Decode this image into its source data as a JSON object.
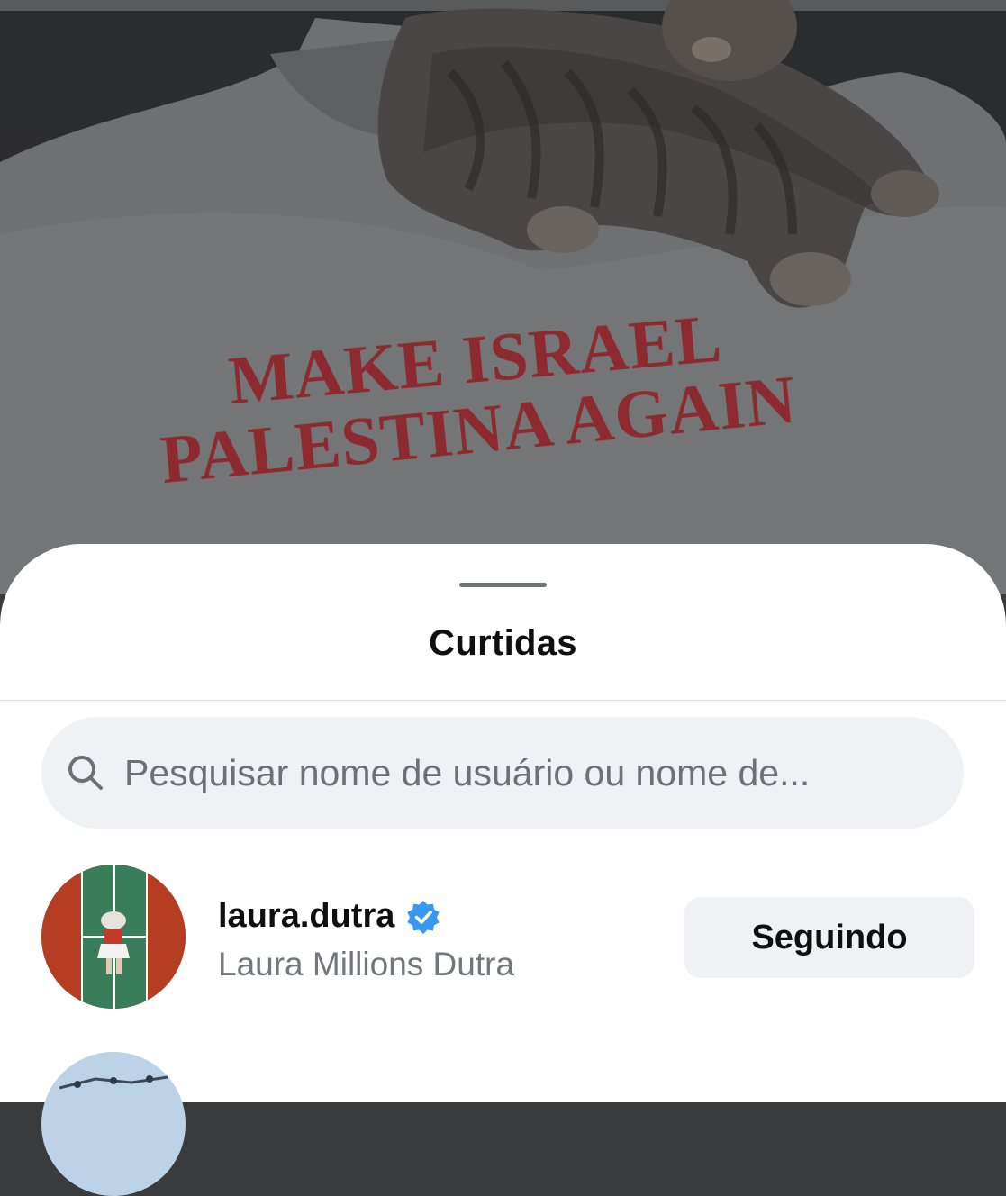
{
  "photo": {
    "shirt_text_line1": "MAKE ISRAEL",
    "shirt_text_line2": "PALESTINA AGAIN"
  },
  "sheet": {
    "title": "Curtidas",
    "search": {
      "placeholder": "Pesquisar nome de usuário ou nome de..."
    },
    "users": [
      {
        "username": "laura.dutra",
        "verified": true,
        "full_name": "Laura Millions Dutra",
        "follow_label": "Seguindo"
      }
    ]
  },
  "colors": {
    "verified_badge": "#3897f0",
    "sheet_bg": "#ffffff",
    "pill_bg": "#eff1f4",
    "shirt_text": "#8c2a2f"
  },
  "icons": {
    "search": "search-icon",
    "verified": "verified-badge-icon"
  }
}
